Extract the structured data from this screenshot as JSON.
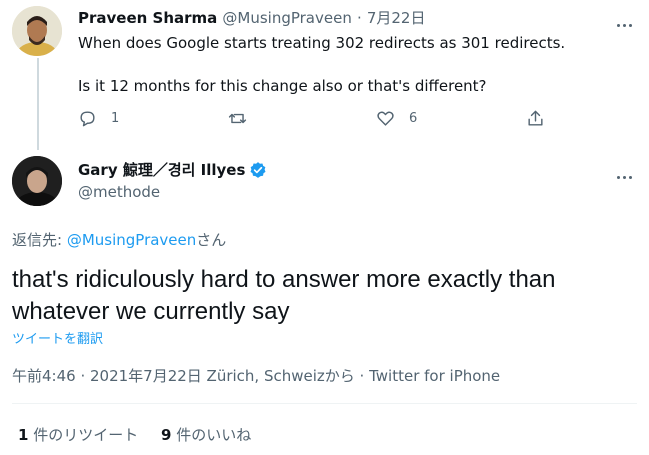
{
  "reply_to_tweet": {
    "author_name": "Praveen Sharma",
    "author_handle": "@MusingPraveen",
    "separator": "·",
    "date": "7月22日",
    "line1": "When does Google starts treating 302 redirects as 301 redirects.",
    "line2": "Is it 12 months for this change also or that's different?",
    "reply_count": "1",
    "like_count": "6",
    "icons": [
      "reply-icon",
      "retweet-icon",
      "like-icon",
      "share-icon"
    ]
  },
  "main_tweet": {
    "author_name": "Gary 鯨理／경리 Illyes",
    "author_handle": "@methode",
    "reply_prefix": "返信先: ",
    "reply_handle": "@MusingPraveen",
    "reply_suffix": "さん",
    "text": "that's ridiculously hard to answer more exactly than whatever we currently say",
    "translate_label": "ツイートを翻訳",
    "meta_time": "午前4:46 · 2021年7月22日 Zürich, Schweizから · Twitter for iPhone",
    "retweet_count": "1",
    "retweet_label": " 件のリツイート",
    "like_count": "9",
    "like_label": " 件のいいね",
    "verified_color": "#1d9bf0"
  }
}
